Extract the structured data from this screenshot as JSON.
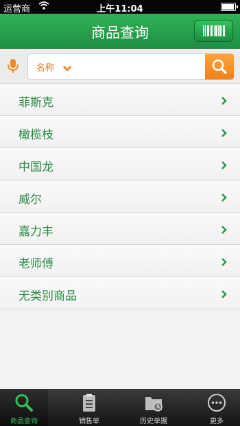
{
  "status": {
    "carrier": "运营商",
    "time": "上午11:04"
  },
  "header": {
    "title": "商品查询"
  },
  "search": {
    "category": "名称"
  },
  "list": [
    {
      "label": "菲斯克"
    },
    {
      "label": "橄榄枝"
    },
    {
      "label": "中国龙"
    },
    {
      "label": "威尔"
    },
    {
      "label": "嘉力丰"
    },
    {
      "label": "老师傅"
    },
    {
      "label": "无类别商品"
    }
  ],
  "tabs": [
    {
      "label": "商品查询",
      "icon": "search-icon"
    },
    {
      "label": "销售单",
      "icon": "clipboard-icon"
    },
    {
      "label": "历史单据",
      "icon": "folder-clock-icon"
    },
    {
      "label": "更多",
      "icon": "more-icon"
    }
  ],
  "colors": {
    "header_green": "#2fb255",
    "accent_orange": "#f59a2e",
    "item_green": "#2b8a43",
    "tab_active": "#31c15c"
  }
}
